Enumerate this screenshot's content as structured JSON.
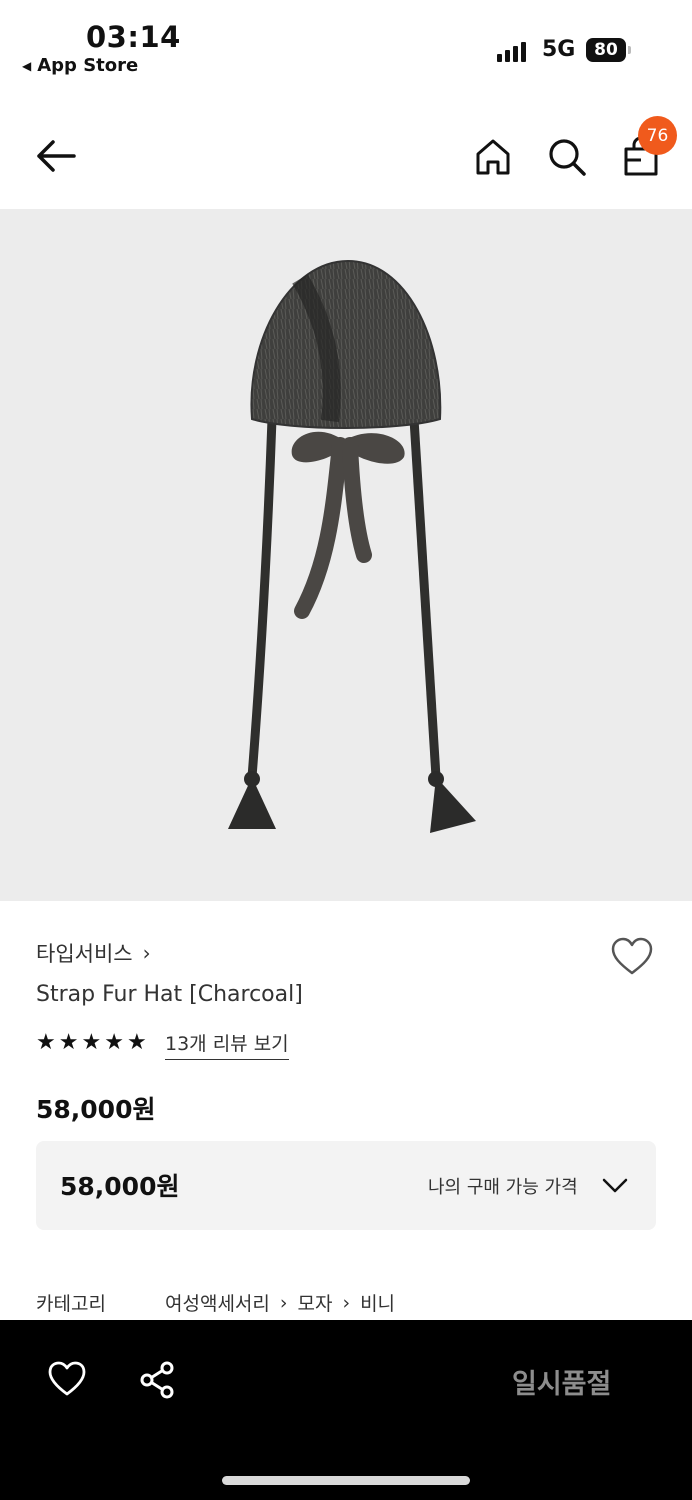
{
  "status_bar": {
    "time": "03:14",
    "back_label": "App Store",
    "network": "5G",
    "battery": "80"
  },
  "nav": {
    "cart_count": "76"
  },
  "product": {
    "brand": "타입서비스",
    "name": "Strap Fur Hat [Charcoal]",
    "rating_stars": 5,
    "review_link": "13개 리뷰 보기",
    "price": "58,000원",
    "my_price": "58,000원",
    "my_price_label": "나의 구매 가능 가격"
  },
  "category": {
    "label": "카테고리",
    "path": [
      "여성액세서리",
      "모자",
      "비니"
    ]
  },
  "bottom_bar": {
    "status": "일시품절"
  },
  "colors": {
    "badge": "#f05a1c",
    "image_bg": "#ececec",
    "soldout_text": "#8d8d8d"
  }
}
